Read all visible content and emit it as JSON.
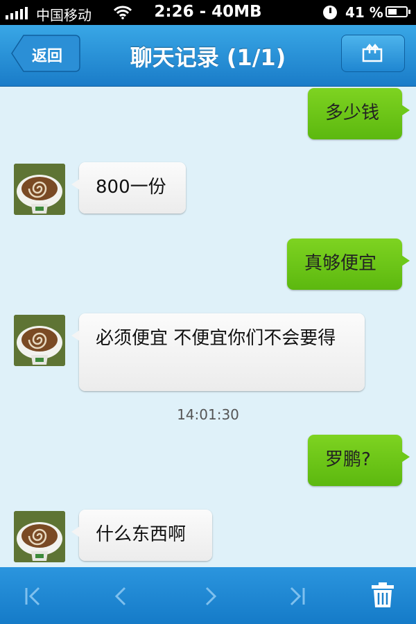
{
  "status_bar": {
    "carrier": "中国移动",
    "time": "2:26 - 40MB",
    "battery": "41 %"
  },
  "nav": {
    "back_label": "返回",
    "title": "聊天记录 (1/1)"
  },
  "messages": [
    {
      "direction": "out",
      "text": "多少钱"
    },
    {
      "direction": "in",
      "text": "800一份"
    },
    {
      "direction": "out",
      "text": "真够便宜"
    },
    {
      "direction": "in",
      "text": "必须便宜 不便宜你们不会要得"
    },
    {
      "timestamp": "14:01:30"
    },
    {
      "direction": "out",
      "text": "罗鹏?"
    },
    {
      "direction": "in",
      "text": "什么东西啊"
    }
  ],
  "toolbar": {
    "icons": [
      "first-page-icon",
      "previous-icon",
      "next-icon",
      "last-page-icon",
      "trash-icon"
    ]
  },
  "colors": {
    "nav_blue": "#1a7cc8",
    "chat_background": "#dff1f9",
    "outgoing_bubble": "#6dc81a",
    "incoming_bubble": "#f4f4f4"
  }
}
